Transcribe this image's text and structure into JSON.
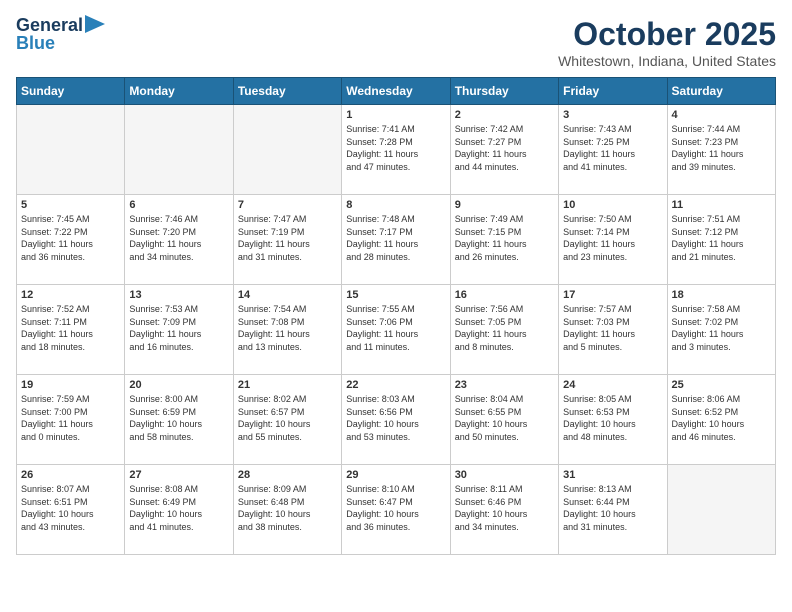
{
  "header": {
    "logo_general": "General",
    "logo_blue": "Blue",
    "title": "October 2025",
    "subtitle": "Whitestown, Indiana, United States"
  },
  "days_of_week": [
    "Sunday",
    "Monday",
    "Tuesday",
    "Wednesday",
    "Thursday",
    "Friday",
    "Saturday"
  ],
  "weeks": [
    [
      {
        "day": "",
        "info": "",
        "empty": true
      },
      {
        "day": "",
        "info": "",
        "empty": true
      },
      {
        "day": "",
        "info": "",
        "empty": true
      },
      {
        "day": "1",
        "info": "Sunrise: 7:41 AM\nSunset: 7:28 PM\nDaylight: 11 hours\nand 47 minutes.",
        "empty": false
      },
      {
        "day": "2",
        "info": "Sunrise: 7:42 AM\nSunset: 7:27 PM\nDaylight: 11 hours\nand 44 minutes.",
        "empty": false
      },
      {
        "day": "3",
        "info": "Sunrise: 7:43 AM\nSunset: 7:25 PM\nDaylight: 11 hours\nand 41 minutes.",
        "empty": false
      },
      {
        "day": "4",
        "info": "Sunrise: 7:44 AM\nSunset: 7:23 PM\nDaylight: 11 hours\nand 39 minutes.",
        "empty": false
      }
    ],
    [
      {
        "day": "5",
        "info": "Sunrise: 7:45 AM\nSunset: 7:22 PM\nDaylight: 11 hours\nand 36 minutes.",
        "empty": false
      },
      {
        "day": "6",
        "info": "Sunrise: 7:46 AM\nSunset: 7:20 PM\nDaylight: 11 hours\nand 34 minutes.",
        "empty": false
      },
      {
        "day": "7",
        "info": "Sunrise: 7:47 AM\nSunset: 7:19 PM\nDaylight: 11 hours\nand 31 minutes.",
        "empty": false
      },
      {
        "day": "8",
        "info": "Sunrise: 7:48 AM\nSunset: 7:17 PM\nDaylight: 11 hours\nand 28 minutes.",
        "empty": false
      },
      {
        "day": "9",
        "info": "Sunrise: 7:49 AM\nSunset: 7:15 PM\nDaylight: 11 hours\nand 26 minutes.",
        "empty": false
      },
      {
        "day": "10",
        "info": "Sunrise: 7:50 AM\nSunset: 7:14 PM\nDaylight: 11 hours\nand 23 minutes.",
        "empty": false
      },
      {
        "day": "11",
        "info": "Sunrise: 7:51 AM\nSunset: 7:12 PM\nDaylight: 11 hours\nand 21 minutes.",
        "empty": false
      }
    ],
    [
      {
        "day": "12",
        "info": "Sunrise: 7:52 AM\nSunset: 7:11 PM\nDaylight: 11 hours\nand 18 minutes.",
        "empty": false
      },
      {
        "day": "13",
        "info": "Sunrise: 7:53 AM\nSunset: 7:09 PM\nDaylight: 11 hours\nand 16 minutes.",
        "empty": false
      },
      {
        "day": "14",
        "info": "Sunrise: 7:54 AM\nSunset: 7:08 PM\nDaylight: 11 hours\nand 13 minutes.",
        "empty": false
      },
      {
        "day": "15",
        "info": "Sunrise: 7:55 AM\nSunset: 7:06 PM\nDaylight: 11 hours\nand 11 minutes.",
        "empty": false
      },
      {
        "day": "16",
        "info": "Sunrise: 7:56 AM\nSunset: 7:05 PM\nDaylight: 11 hours\nand 8 minutes.",
        "empty": false
      },
      {
        "day": "17",
        "info": "Sunrise: 7:57 AM\nSunset: 7:03 PM\nDaylight: 11 hours\nand 5 minutes.",
        "empty": false
      },
      {
        "day": "18",
        "info": "Sunrise: 7:58 AM\nSunset: 7:02 PM\nDaylight: 11 hours\nand 3 minutes.",
        "empty": false
      }
    ],
    [
      {
        "day": "19",
        "info": "Sunrise: 7:59 AM\nSunset: 7:00 PM\nDaylight: 11 hours\nand 0 minutes.",
        "empty": false
      },
      {
        "day": "20",
        "info": "Sunrise: 8:00 AM\nSunset: 6:59 PM\nDaylight: 10 hours\nand 58 minutes.",
        "empty": false
      },
      {
        "day": "21",
        "info": "Sunrise: 8:02 AM\nSunset: 6:57 PM\nDaylight: 10 hours\nand 55 minutes.",
        "empty": false
      },
      {
        "day": "22",
        "info": "Sunrise: 8:03 AM\nSunset: 6:56 PM\nDaylight: 10 hours\nand 53 minutes.",
        "empty": false
      },
      {
        "day": "23",
        "info": "Sunrise: 8:04 AM\nSunset: 6:55 PM\nDaylight: 10 hours\nand 50 minutes.",
        "empty": false
      },
      {
        "day": "24",
        "info": "Sunrise: 8:05 AM\nSunset: 6:53 PM\nDaylight: 10 hours\nand 48 minutes.",
        "empty": false
      },
      {
        "day": "25",
        "info": "Sunrise: 8:06 AM\nSunset: 6:52 PM\nDaylight: 10 hours\nand 46 minutes.",
        "empty": false
      }
    ],
    [
      {
        "day": "26",
        "info": "Sunrise: 8:07 AM\nSunset: 6:51 PM\nDaylight: 10 hours\nand 43 minutes.",
        "empty": false
      },
      {
        "day": "27",
        "info": "Sunrise: 8:08 AM\nSunset: 6:49 PM\nDaylight: 10 hours\nand 41 minutes.",
        "empty": false
      },
      {
        "day": "28",
        "info": "Sunrise: 8:09 AM\nSunset: 6:48 PM\nDaylight: 10 hours\nand 38 minutes.",
        "empty": false
      },
      {
        "day": "29",
        "info": "Sunrise: 8:10 AM\nSunset: 6:47 PM\nDaylight: 10 hours\nand 36 minutes.",
        "empty": false
      },
      {
        "day": "30",
        "info": "Sunrise: 8:11 AM\nSunset: 6:46 PM\nDaylight: 10 hours\nand 34 minutes.",
        "empty": false
      },
      {
        "day": "31",
        "info": "Sunrise: 8:13 AM\nSunset: 6:44 PM\nDaylight: 10 hours\nand 31 minutes.",
        "empty": false
      },
      {
        "day": "",
        "info": "",
        "empty": true
      }
    ]
  ]
}
